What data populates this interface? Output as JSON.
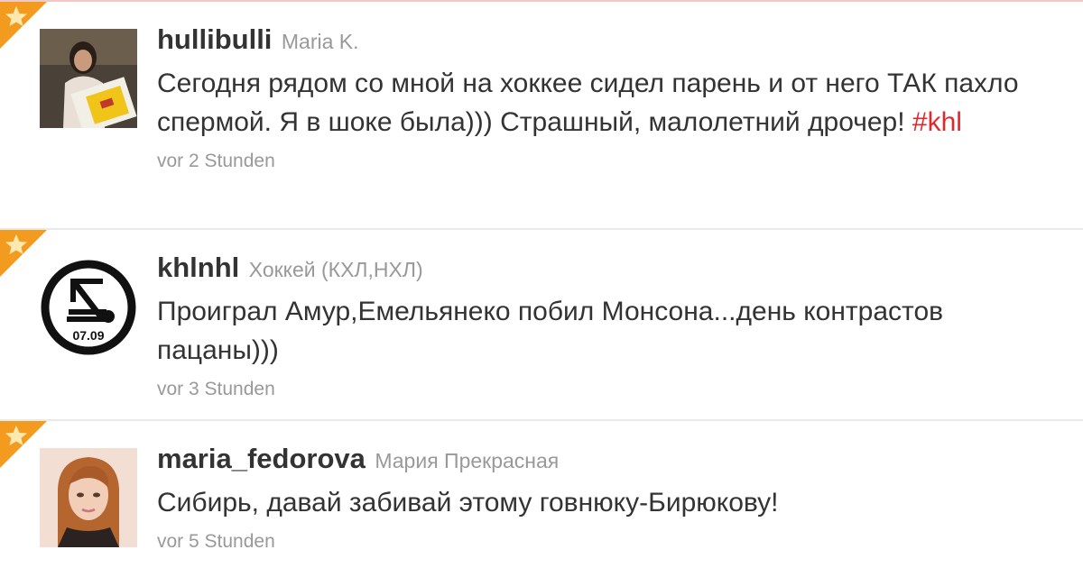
{
  "tweets": [
    {
      "screen_name": "hullibulli",
      "full_name": "Maria K.",
      "text": "Сегодня рядом со мной на хоккее сидел парень и от него ТАК пахло спермой. Я в шоке была))) Страшный, малолетний дрочер! ",
      "hashtag": "#khl",
      "time": "vor 2 Stunden",
      "avatar_icon": "photo-avatar"
    },
    {
      "screen_name": "khlnhl",
      "full_name": "Хоккей (КХЛ,НХЛ)",
      "text": "Проиграл Амур,Емельянеко побил Монсона...день контрастов пацаны)))",
      "time": "vor 3 Stunden",
      "avatar_text": "07.09",
      "avatar_icon": "lokomotiv-logo"
    },
    {
      "screen_name": "maria_fedorova",
      "full_name": "Мария Прекрасная",
      "text": "Сибирь, давай забивай этому говнюку-Бирюкову!",
      "time": "vor 5 Stunden",
      "avatar_icon": "photo-avatar"
    }
  ],
  "colors": {
    "favorite_corner": "#f39b1f",
    "hashtag": "#e0292c",
    "muted": "#999999",
    "text": "#333333"
  }
}
